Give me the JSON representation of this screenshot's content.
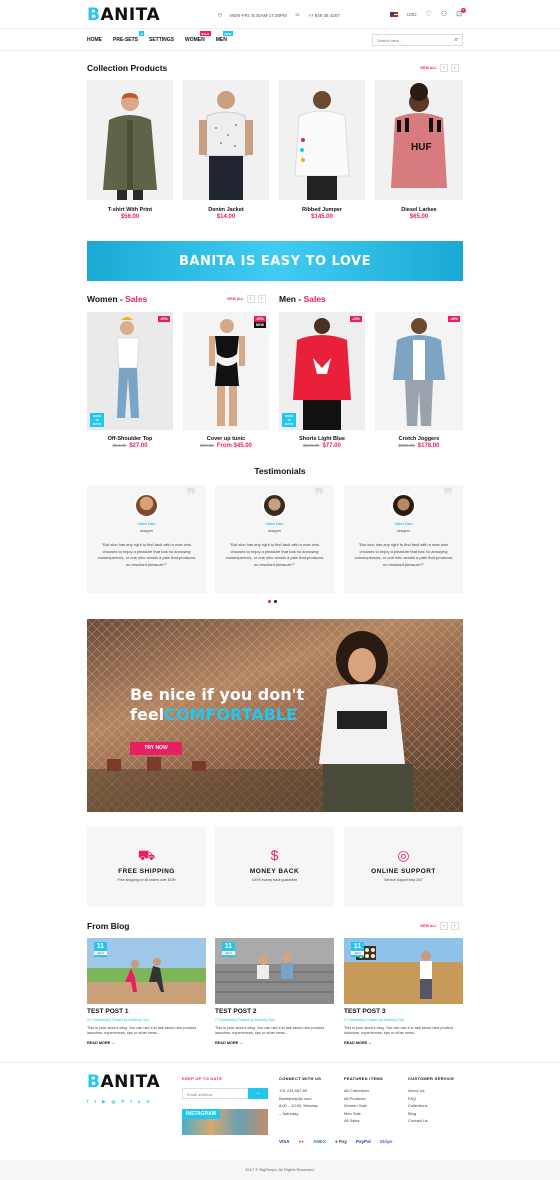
{
  "header": {
    "logo_first": "B",
    "logo_rest": "ANITA",
    "hours": "MON-FRI: 8:30AM-17:30PM",
    "phone": "+7 849 35 4267",
    "currency": "USD"
  },
  "nav": {
    "items": [
      "HOME",
      "PRE-SETS",
      "SETTINGS",
      "WOMEN",
      "MEN"
    ],
    "tags": {
      "presets": "8",
      "women": "SALE",
      "men": "NEW"
    },
    "search_placeholder": "Search here..."
  },
  "collection": {
    "title": "Collection Products",
    "view_all": "VIEW ALL",
    "products": [
      {
        "name": "T-shirt With Print",
        "price": "$56.00"
      },
      {
        "name": "Denim Jacket",
        "price": "$14.00"
      },
      {
        "name": "Ribbed Jumper",
        "price": "$145.00"
      },
      {
        "name": "Diesel Larkee",
        "price": "$65.00"
      }
    ]
  },
  "banner": {
    "text": "BANITA IS EASY TO LOVE"
  },
  "sales": {
    "women_title": "Women - ",
    "men_title": "Men - ",
    "sales_word": "Sales",
    "view_all": "VIEW ALL",
    "products": [
      {
        "name": "Off-Shoulder Top",
        "old": "$54.00",
        "price": "$27.00",
        "badge": "-50%",
        "extra": "SAVE 10 DAYS"
      },
      {
        "name": "Cover up tunic",
        "old": "$90.00",
        "price": "From $45.00",
        "badge": "-50%",
        "extra": "NEW"
      },
      {
        "name": "Shorts Light Blue",
        "old": "$100.00",
        "price": "$77.00",
        "badge": "-23%",
        "extra": "SAVE 10 DAYS"
      },
      {
        "name": "Crotch Joggers",
        "old": "$300.00",
        "price": "$178.00",
        "badge": "-40%",
        "extra": ""
      }
    ]
  },
  "testimonials": {
    "title": "Testimonials",
    "items": [
      {
        "name": "John Doe",
        "role": "designer",
        "text": "\"But who has any right to find fault with a man who chooses to enjoy a pleasure that has no annoying consequences, or one who avoids a pain that produces no resultant pleasure?\""
      },
      {
        "name": "John Doe",
        "role": "designer",
        "text": "\"But who has any right to find fault with a man who chooses to enjoy a pleasure that has no annoying consequences, or one who avoids a pain that produces no resultant pleasure?\""
      },
      {
        "name": "John Doe",
        "role": "designer",
        "text": "\"But who has any right to find fault with a man who chooses to enjoy a pleasure that has no annoying consequences, or one who avoids a pain that produces no resultant pleasure?\""
      }
    ]
  },
  "hero": {
    "line1": "Be nice if you don't",
    "line2a": "feel",
    "line2b": "COMFORTABLE",
    "button": "TRY NOW"
  },
  "features": [
    {
      "title": "FREE SHIPPING",
      "sub": "Free shipping on all orders over $199"
    },
    {
      "title": "MONEY BACK",
      "sub": "100% money back guarantee"
    },
    {
      "title": "ONLINE SUPPORT",
      "sub": "Service support fast 24/7"
    }
  ],
  "blog": {
    "title": "From Blog",
    "view_all": "VIEW ALL",
    "posts": [
      {
        "day": "11",
        "month": "April",
        "title": "TEST POST 1",
        "meta": "10 Comment(s) Posted by Anthony Gali",
        "text": "This is your store's blog. You can use it to talk about new product launches, experiences, tips or other news...",
        "more": "READ MORE →"
      },
      {
        "day": "11",
        "month": "April",
        "title": "TEST POST 2",
        "meta": "7 Comment(s) Posted by Anthony Gali",
        "text": "This is your store's blog. You can use it to talk about new product launches, experiences, tips or other news...",
        "more": "READ MORE →"
      },
      {
        "day": "11",
        "month": "April",
        "title": "TEST POST 3",
        "meta": "3 Comment(s) Posted by Anthony Gali",
        "text": "This is your store's blog. You can use it to talk about new product launches, experiences, tips or other news...",
        "more": "READ MORE →"
      }
    ]
  },
  "footer": {
    "keep_title": "KEEP UP TO DATE",
    "email_placeholder": "Email address",
    "instagram": "INSTAGRAM",
    "connect_title": "CONNECT WITH US",
    "connect": [
      "+01 234 567 89",
      "Banitahelp@i.com",
      "8:00 – 10:00, Monday",
      "– Saturday"
    ],
    "featured_title": "FEATURED ITEMS",
    "featured": [
      "All Collections",
      "All Products",
      "Women Sale",
      "Men Sale",
      "All Sales"
    ],
    "service_title": "CUSTOMER SERVICE",
    "service": [
      "About Us",
      "FAQ",
      "Collections",
      "Blog",
      "Contact Us"
    ],
    "payments": [
      "VISA",
      "●●",
      "AMEX",
      "● Pay",
      "PayPal",
      "Stripe"
    ],
    "social": [
      "f",
      "t",
      "▶",
      "◎",
      "P",
      "t",
      "a",
      "V"
    ],
    "copyright": "2017 © BigShops. All Rights Reserved."
  }
}
